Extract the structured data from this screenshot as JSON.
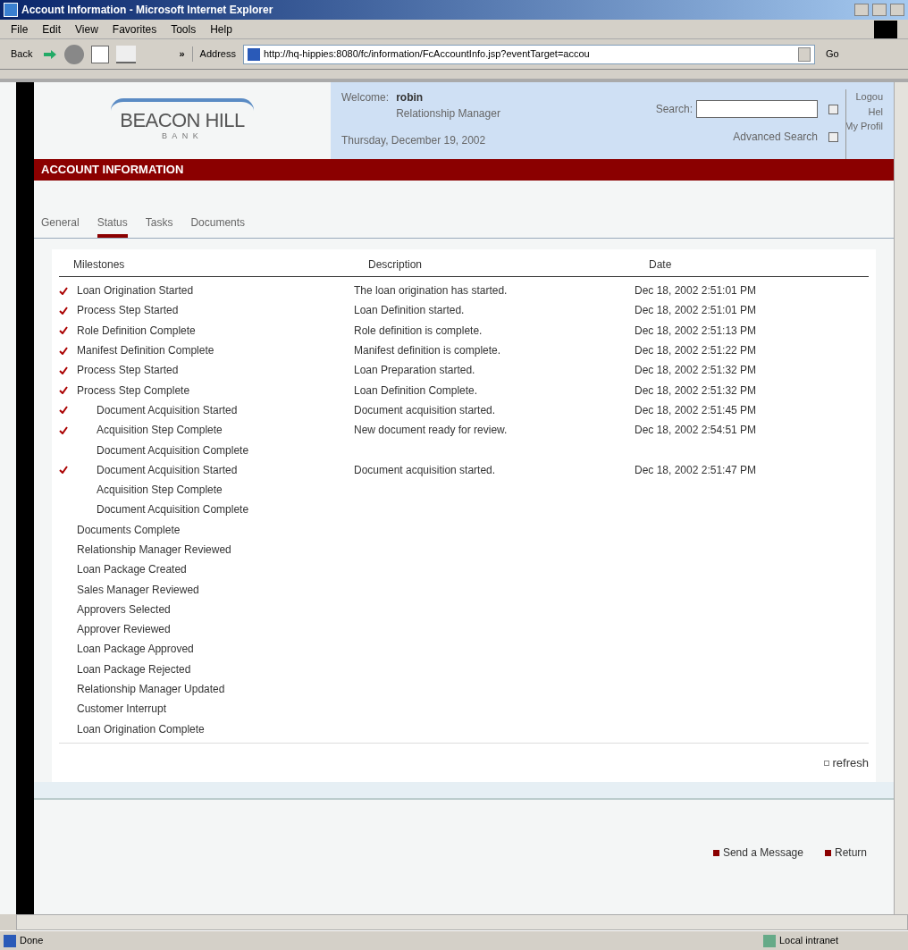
{
  "window": {
    "title": "Account Information - Microsoft Internet Explorer"
  },
  "menu": [
    "File",
    "Edit",
    "View",
    "Favorites",
    "Tools",
    "Help"
  ],
  "toolbar": {
    "back": "Back",
    "address_label": "Address",
    "address": "http://hq-hippies:8080/fc/information/FcAccountInfo.jsp?eventTarget=accou",
    "go": "Go",
    "chevron": "»"
  },
  "header": {
    "logo": "BEACON HILL",
    "logo_sub": "BANK",
    "welcome_label": "Welcome:",
    "user": "robin",
    "role": "Relationship Manager",
    "date": "Thursday, December 19, 2002",
    "search_label": "Search:",
    "advanced_search": "Advanced Search",
    "links": [
      "Logou",
      "Hel",
      "My Profil"
    ]
  },
  "page_title": "ACCOUNT INFORMATION",
  "tabs": [
    {
      "label": "General",
      "selected": false
    },
    {
      "label": "Status",
      "selected": true
    },
    {
      "label": "Tasks",
      "selected": false
    },
    {
      "label": "Documents",
      "selected": false
    }
  ],
  "table": {
    "columns": [
      "Milestones",
      "Description",
      "Date"
    ],
    "rows": [
      {
        "milestone": "Loan Origination Started",
        "checked": true,
        "description": "The loan origination has started.",
        "date": "Dec 18, 2002 2:51:01 PM"
      },
      {
        "milestone": "Process Step Started",
        "checked": true,
        "description": "Loan Definition started.",
        "date": "Dec 18, 2002 2:51:01 PM"
      },
      {
        "milestone": "Role Definition Complete",
        "checked": true,
        "description": "Role definition is complete.",
        "date": "Dec 18, 2002 2:51:13 PM"
      },
      {
        "milestone": "Manifest Definition Complete",
        "checked": true,
        "description": "Manifest definition is complete.",
        "date": "Dec 18, 2002 2:51:22 PM"
      },
      {
        "milestone": "Process Step Started",
        "checked": true,
        "description": "Loan Preparation started.",
        "date": "Dec 18, 2002 2:51:32 PM"
      },
      {
        "milestone": "Process Step Complete",
        "checked": true,
        "description": "Loan Definition Complete.",
        "date": "Dec 18, 2002 2:51:32 PM",
        "children": [
          {
            "milestone": "Document Acquisition Started",
            "checked": true,
            "description": "Document acquisition started.",
            "date": "Dec 18, 2002 2:51:45 PM"
          },
          {
            "milestone": "Acquisition Step Complete",
            "checked": true,
            "description": "New document ready for review.",
            "date": "Dec 18, 2002 2:54:51 PM"
          },
          {
            "milestone": "Document Acquisition Complete",
            "checked": false
          },
          {
            "milestone": "Document Acquisition Started",
            "checked": true,
            "description": "Document acquisition started.",
            "date": "Dec 18, 2002 2:51:47 PM"
          },
          {
            "milestone": "Acquisition Step Complete",
            "checked": false
          },
          {
            "milestone": "Document Acquisition Complete",
            "checked": false
          }
        ]
      },
      {
        "milestone": "Documents Complete",
        "checked": false
      },
      {
        "milestone": "Relationship Manager Reviewed",
        "checked": false
      },
      {
        "milestone": "Loan Package Created",
        "checked": false
      },
      {
        "milestone": "Sales Manager Reviewed",
        "checked": false
      },
      {
        "milestone": "Approvers Selected",
        "checked": false
      },
      {
        "milestone": "Approver Reviewed",
        "checked": false
      },
      {
        "milestone": "Loan Package Approved",
        "checked": false
      },
      {
        "milestone": "Loan Package Rejected",
        "checked": false
      },
      {
        "milestone": "Relationship Manager Updated",
        "checked": false
      },
      {
        "milestone": "Customer Interrupt",
        "checked": false
      },
      {
        "milestone": "Loan Origination Complete",
        "checked": false
      }
    ]
  },
  "refresh": "refresh",
  "footer_links": [
    "Send a Message",
    "Return"
  ],
  "status_bar": {
    "text": "Done",
    "zone": "Local intranet"
  }
}
